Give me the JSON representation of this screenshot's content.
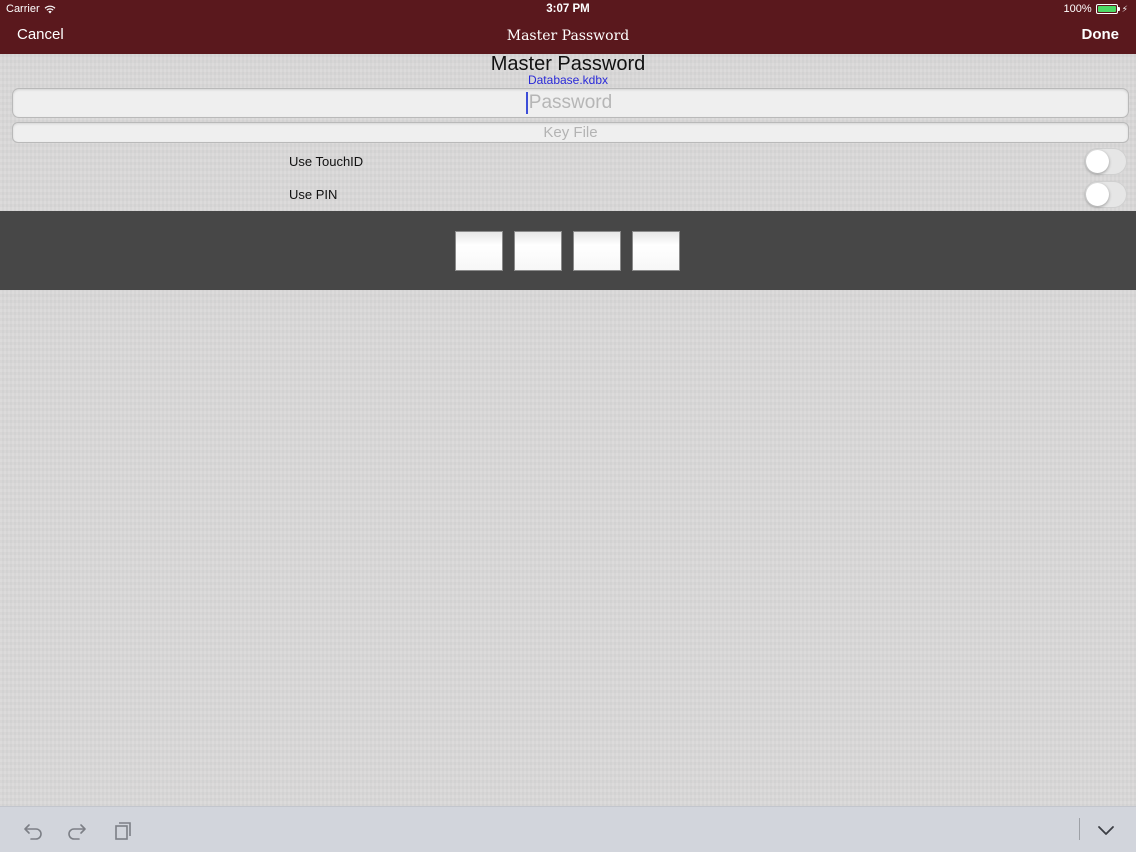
{
  "status_bar": {
    "carrier": "Carrier",
    "time": "3:07 PM",
    "battery": "100%"
  },
  "nav": {
    "cancel_label": "Cancel",
    "title": "Master Password",
    "done_label": "Done"
  },
  "header": {
    "title": "Master Password",
    "database": "Database.kdbx"
  },
  "form": {
    "password_placeholder": "Password",
    "password_value": "",
    "keyfile_label": "Key File",
    "touchid_label": "Use TouchID",
    "touchid_on": false,
    "pin_label": "Use PIN",
    "pin_on": false,
    "pin_digits": [
      "",
      "",
      "",
      ""
    ]
  },
  "colors": {
    "nav_background": "#5a181d",
    "database_link": "#2a2ad8",
    "pin_panel": "#474747"
  },
  "icons": {
    "undo": "undo-icon",
    "redo": "redo-icon",
    "paste": "paste-icon",
    "dismiss": "chevron-down-icon"
  }
}
